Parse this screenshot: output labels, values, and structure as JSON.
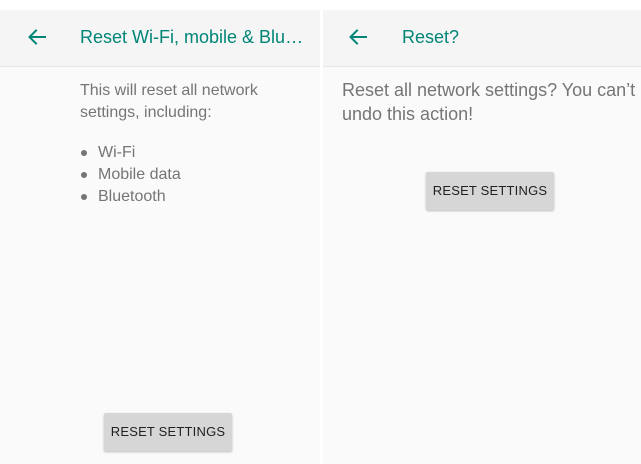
{
  "left": {
    "title": "Reset Wi-Fi, mobile & Bluetooth",
    "description": "This will reset all network settings, including:",
    "items": [
      "Wi-Fi",
      "Mobile data",
      "Bluetooth"
    ],
    "button_label": "RESET SETTINGS",
    "back_icon": "arrow-back-icon"
  },
  "right": {
    "title": "Reset?",
    "description": "Reset all network settings? You can’t undo this action!",
    "button_label": "RESET SETTINGS",
    "back_icon": "arrow-back-icon"
  },
  "colors": {
    "accent": "#008577",
    "background": "#fafafa",
    "text_secondary": "#757575",
    "button": "#d6d6d6"
  }
}
